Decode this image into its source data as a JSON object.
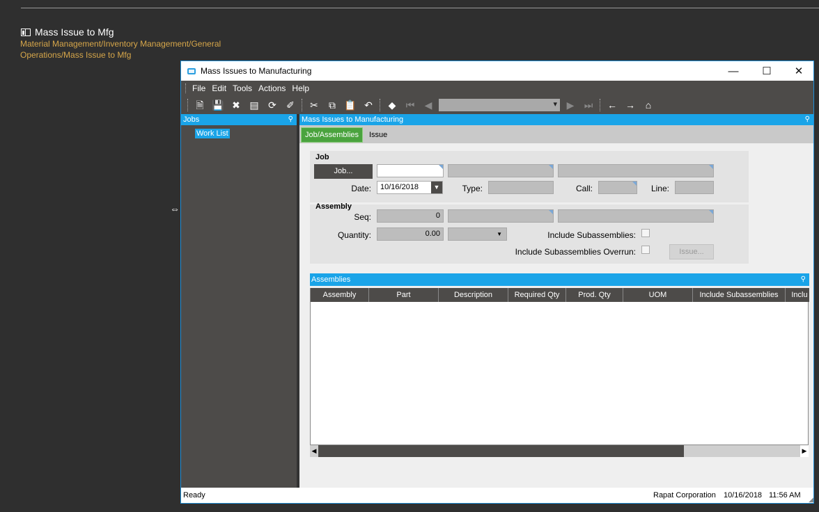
{
  "background": {
    "title": "Mass Issue to Mfg",
    "menu_path": "Material Management/Inventory Management/General Operations/Mass Issue to Mfg"
  },
  "window": {
    "title": "Mass Issues to Manufacturing",
    "menu": [
      "File",
      "Edit",
      "Tools",
      "Actions",
      "Help"
    ]
  },
  "jobs_panel": {
    "header": "Jobs",
    "item": "Work List"
  },
  "main_panel": {
    "header": "Mass Issues to Manufacturing",
    "tabs": [
      "Job/Assemblies",
      "Issue"
    ],
    "job_group": {
      "label": "Job",
      "job_button": "Job...",
      "job_value": "",
      "date_label": "Date:",
      "date_value": "10/16/2018",
      "type_label": "Type:",
      "call_label": "Call:",
      "line_label": "Line:"
    },
    "assembly_group": {
      "label": "Assembly",
      "seq_label": "Seq:",
      "seq_value": "0",
      "quantity_label": "Quantity:",
      "quantity_value": "0.00",
      "include_sub_label": "Include Subassemblies:",
      "include_sub_overrun_label": "Include Subassemblies Overrun:",
      "issue_button": "Issue..."
    },
    "assemblies": {
      "header": "Assemblies",
      "columns": [
        "Assembly",
        "Part",
        "Description",
        "Required Qty",
        "Prod. Qty",
        "UOM",
        "Include Subassemblies",
        "Inclu"
      ]
    }
  },
  "status": {
    "left": "Ready",
    "company": "Rapat Corporation",
    "date": "10/16/2018",
    "time": "11:56 AM"
  }
}
